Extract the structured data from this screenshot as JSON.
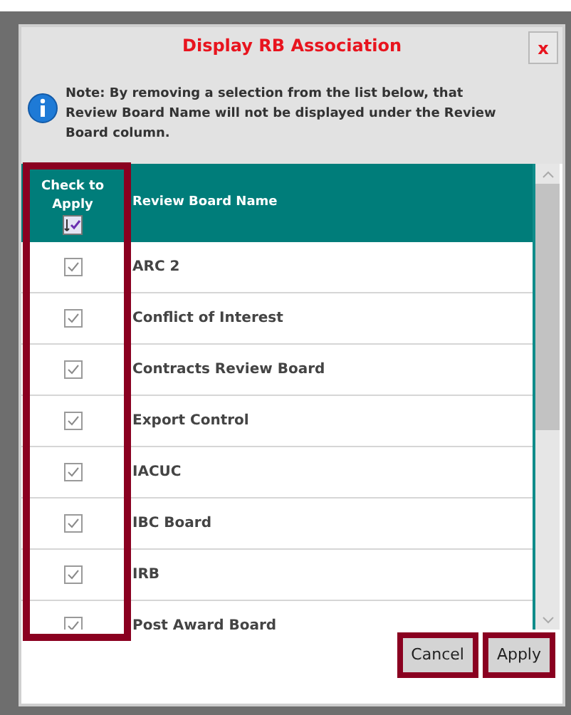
{
  "dialog": {
    "title": "Display RB Association",
    "close_label": "x",
    "note": "Note: By removing a selection from the list below, that Review Board Name will not be displayed under the Review Board column."
  },
  "table": {
    "columns": [
      "Check to Apply",
      "Review Board Name"
    ],
    "select_all_highlighted": true,
    "rows": [
      {
        "name": "ARC 2",
        "checked": true
      },
      {
        "name": "Conflict of Interest",
        "checked": true
      },
      {
        "name": "Contracts Review Board",
        "checked": true
      },
      {
        "name": "Export Control",
        "checked": true
      },
      {
        "name": "IACUC",
        "checked": true
      },
      {
        "name": "IBC Board",
        "checked": true
      },
      {
        "name": "IRB",
        "checked": true
      },
      {
        "name": "Post Award Board",
        "checked": true
      }
    ]
  },
  "buttons": [
    {
      "label": "Cancel",
      "highlighted": true
    },
    {
      "label": "Apply",
      "highlighted": true
    }
  ]
}
